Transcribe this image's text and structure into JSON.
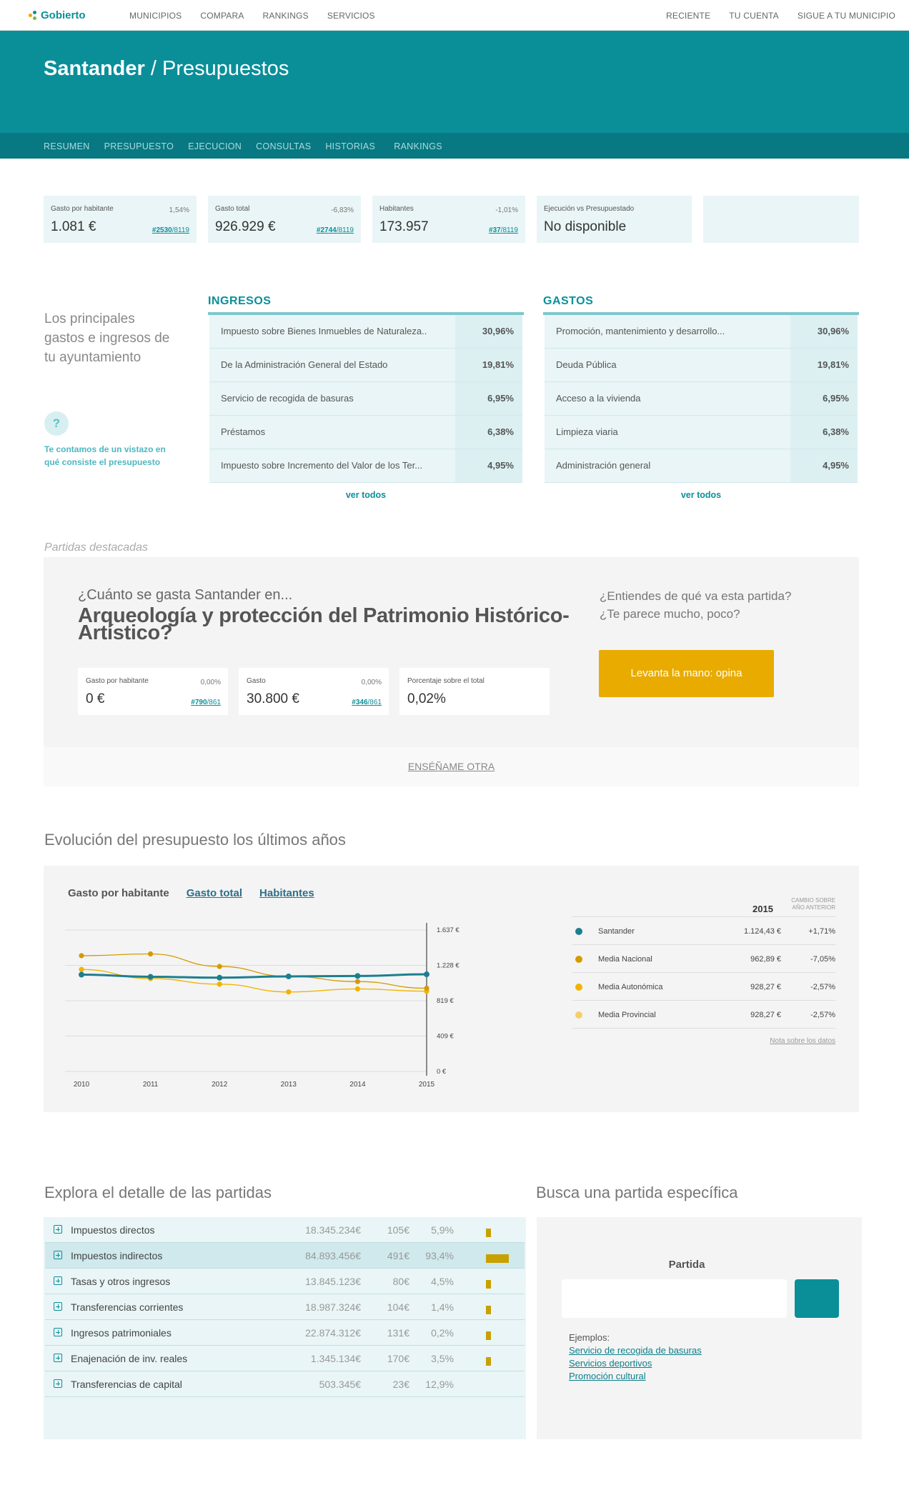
{
  "topbar": {
    "logo": "Gobierto",
    "left_nav": [
      "MUNICIPIOS",
      "COMPARA",
      "RANKINGS",
      "SERVICIOS"
    ],
    "right_nav": [
      "RECIENTE",
      "TU CUENTA",
      "SIGUE A TU MUNICIPIO"
    ]
  },
  "hero": {
    "city": "Santander",
    "sep": " / ",
    "section": "Presupuestos"
  },
  "subnav": [
    "RESUMEN",
    "PRESUPUESTO",
    "EJECUCION",
    "CONSULTAS",
    "HISTORIAS",
    "RANKINGS"
  ],
  "stats": [
    {
      "label": "Gasto por habitante",
      "change": "1,54%",
      "value": "1.081 €",
      "rank": "#2530",
      "rank_of": "/8119"
    },
    {
      "label": "Gasto total",
      "change": "-6,83%",
      "value": "926.929 €",
      "rank": "#2744",
      "rank_of": "/8119"
    },
    {
      "label": "Habitantes",
      "change": "-1,01%",
      "value": "173.957",
      "rank": "#37",
      "rank_of": "/8119"
    },
    {
      "label": "Ejecución vs Presupuestado",
      "value": "No disponible"
    }
  ],
  "intro": {
    "text": "Los principales gastos e ingresos de tu ayuntamiento",
    "help_icon": "?",
    "help_text": "Te contamos de un vistazo en qué consiste el presupuesto"
  },
  "ingresos": {
    "title": "INGRESOS",
    "rows": [
      {
        "name": "Impuesto sobre Bienes Inmuebles de Naturaleza..",
        "pct": "30,96%"
      },
      {
        "name": "De la Administración General del Estado",
        "pct": "19,81%"
      },
      {
        "name": "Servicio de recogida de basuras",
        "pct": "6,95%"
      },
      {
        "name": "Préstamos",
        "pct": "6,38%"
      },
      {
        "name": "Impuesto sobre Incremento del Valor de los Ter...",
        "pct": "4,95%"
      }
    ],
    "more": "ver todos"
  },
  "gastos": {
    "title": "GASTOS",
    "rows": [
      {
        "name": "Promoción, mantenimiento y desarrollo...",
        "pct": "30,96%"
      },
      {
        "name": "Deuda Pública",
        "pct": "19,81%"
      },
      {
        "name": "Acceso a la vivienda",
        "pct": "6,95%"
      },
      {
        "name": "Limpieza viaria",
        "pct": "6,38%"
      },
      {
        "name": "Administración general",
        "pct": "4,95%"
      }
    ],
    "more": "ver todos"
  },
  "featured": {
    "caption": "Partidas destacadas",
    "question": "¿Cuánto se gasta Santander en...",
    "headline": "Arqueología y protección del Patrimonio Histórico-Artístico?",
    "cards": [
      {
        "label": "Gasto por habitante",
        "change": "0,00%",
        "value": "0 €",
        "rank": "#790",
        "rank_of": "/861"
      },
      {
        "label": "Gasto",
        "change": "0,00%",
        "value": "30.800 €",
        "rank": "#346",
        "rank_of": "/861"
      },
      {
        "label": "Porcentaje sobre el total",
        "value": "0,02%"
      }
    ],
    "ask_line1": "¿Entiendes de qué va esta partida?",
    "ask_line2": "¿Te parece mucho, poco?",
    "button": "Levanta la mano: opina",
    "more": "ENSÉÑAME OTRA"
  },
  "evolution": {
    "title": "Evolución del presupuesto los últimos años",
    "tabs": {
      "active": "Gasto por habitante",
      "t2": "Gasto total",
      "t3": "Habitantes"
    },
    "legend_year": "2015",
    "legend_change_l1": "CAMBIO SOBRE",
    "legend_change_l2": "AÑO ANTERIOR",
    "legend": [
      {
        "name": "Santander",
        "value": "1.124,43 €",
        "change": "+1,71%",
        "color": "#1d7e8f"
      },
      {
        "name": "Media Nacional",
        "value": "962,89 €",
        "change": "-7,05%",
        "color": "#d39b00"
      },
      {
        "name": "Media Autonómica",
        "value": "928,27 €",
        "change": "-2,57%",
        "color": "#f0b400"
      },
      {
        "name": "Media Provincial",
        "value": "928,27 €",
        "change": "-2,57%",
        "color": "#f5cf6a"
      }
    ],
    "note": "Nota sobre los datos"
  },
  "chart_data": {
    "type": "line",
    "x": [
      "2010",
      "2011",
      "2012",
      "2013",
      "2014",
      "2015"
    ],
    "y_ticks": [
      "1.637 €",
      "1.228 €",
      "819 €",
      "409 €",
      "0 €"
    ],
    "ylim": [
      0,
      1637
    ],
    "series": [
      {
        "name": "Santander",
        "color": "#1d7e8f",
        "values": [
          1120,
          1095,
          1085,
          1100,
          1105,
          1124
        ]
      },
      {
        "name": "Media Nacional",
        "color": "#d39b00",
        "values": [
          1340,
          1360,
          1215,
          1100,
          1040,
          963
        ]
      },
      {
        "name": "Media Autonómica",
        "color": "#f0b400",
        "values": [
          1180,
          1075,
          1010,
          920,
          955,
          928
        ]
      },
      {
        "name": "Media Provincial",
        "color": "#f5cf6a",
        "values": [
          1180,
          1075,
          1010,
          920,
          955,
          928
        ]
      }
    ]
  },
  "explore": {
    "title": "Explora el detalle de las partidas",
    "rows": [
      {
        "name": "Impuestos directos",
        "total": "18.345.234€",
        "per": "105€",
        "pct": "5,9%",
        "share": 0.059
      },
      {
        "name": "Impuestos indirectos",
        "total": "84.893.456€",
        "per": "491€",
        "pct": "93,4%",
        "share": 0.934
      },
      {
        "name": "Tasas y otros ingresos",
        "total": "13.845.123€",
        "per": "80€",
        "pct": "4,5%",
        "share": 0.045
      },
      {
        "name": "Transferencias corrientes",
        "total": "18.987.324€",
        "per": "104€",
        "pct": "1,4%",
        "share": 0.014
      },
      {
        "name": "Ingresos patrimoniales",
        "total": "22.874.312€",
        "per": "131€",
        "pct": "0,2%",
        "share": 0.002
      },
      {
        "name": "Enajenación de inv. reales",
        "total": "1.345.134€",
        "per": "170€",
        "pct": "3,5%",
        "share": 0.035
      },
      {
        "name": "Transferencias de capital",
        "total": "503.345€",
        "per": "23€",
        "pct": "12,9%",
        "share": 0
      }
    ]
  },
  "search": {
    "title": "Busca una partida específica",
    "label": "Partida",
    "placeholder": "",
    "examples_label": "Ejemplos:",
    "examples": [
      "Servicio de recogida de basuras",
      "Servicios deportivos",
      "Promoción cultural"
    ]
  }
}
